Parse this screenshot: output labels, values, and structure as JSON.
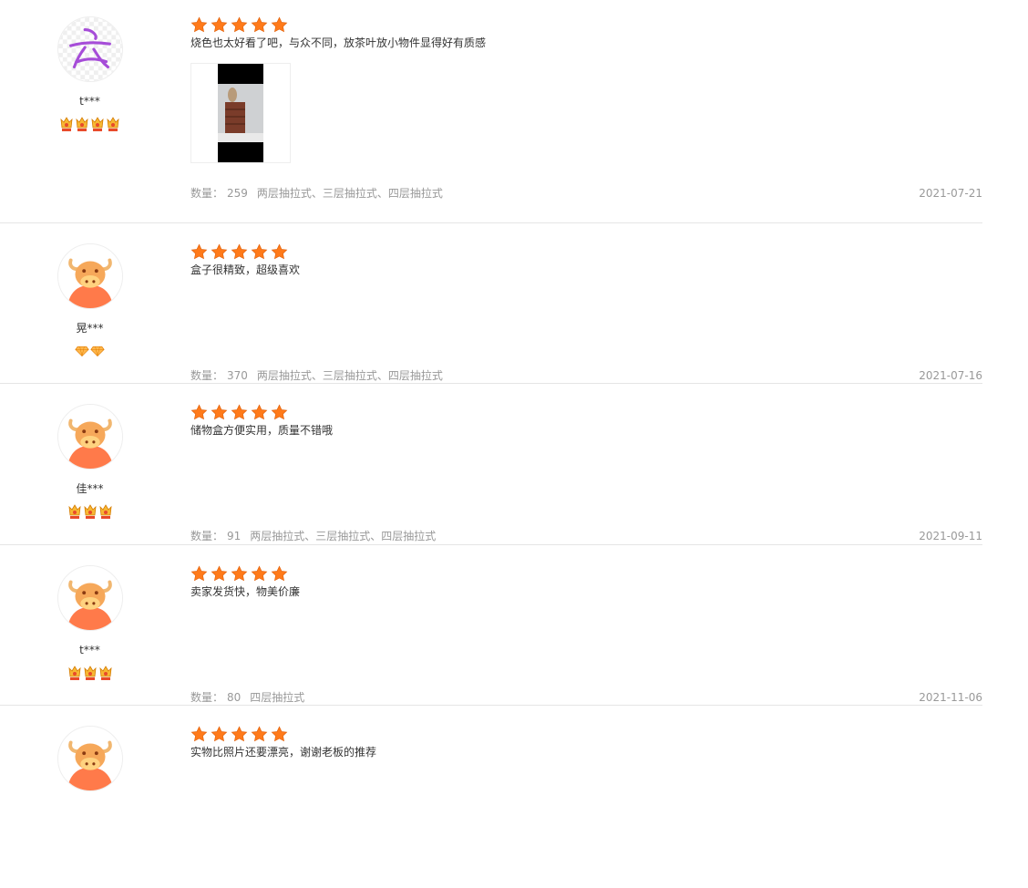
{
  "reviews": [
    {
      "user": "t***",
      "level": "crown",
      "level_count": 4,
      "rating": 5,
      "text": "烧色也太好看了吧，与众不同，放茶叶放小物件显得好有质感",
      "has_photo": true,
      "qty_label": "数量：",
      "qty": "259",
      "options": "两层抽拉式、三层抽拉式、四层抽拉式",
      "date": "2021-07-21",
      "avatar": "sketch"
    },
    {
      "user": "晃***",
      "level": "diamond",
      "level_count": 2,
      "rating": 5,
      "text": "盒子很精致，超级喜欢",
      "has_photo": false,
      "qty_label": "数量：",
      "qty": "370",
      "options": "两层抽拉式、三层抽拉式、四层抽拉式",
      "date": "2021-07-16",
      "avatar": "ox"
    },
    {
      "user": "佳***",
      "level": "crown",
      "level_count": 3,
      "rating": 5,
      "text": "储物盒方便实用，质量不错哦",
      "has_photo": false,
      "qty_label": "数量：",
      "qty": "91",
      "options": "两层抽拉式、三层抽拉式、四层抽拉式",
      "date": "2021-09-11",
      "avatar": "ox"
    },
    {
      "user": "t***",
      "level": "crown",
      "level_count": 3,
      "rating": 5,
      "text": "卖家发货快，物美价廉",
      "has_photo": false,
      "qty_label": "数量：",
      "qty": "80",
      "options": "四层抽拉式",
      "date": "2021-11-06",
      "avatar": "ox"
    },
    {
      "user": "",
      "level": "crown",
      "level_count": 0,
      "rating": 5,
      "text": "实物比照片还要漂亮，谢谢老板的推荐",
      "has_photo": false,
      "qty_label": "",
      "qty": "",
      "options": "",
      "date": "",
      "avatar": "ox"
    }
  ],
  "colors": {
    "star": "#ff7a1a",
    "meta": "#999999",
    "divider": "#e5e5e5"
  },
  "icons": {
    "star": "star-icon",
    "crown": "crown-badge-icon",
    "diamond": "diamond-badge-icon"
  }
}
